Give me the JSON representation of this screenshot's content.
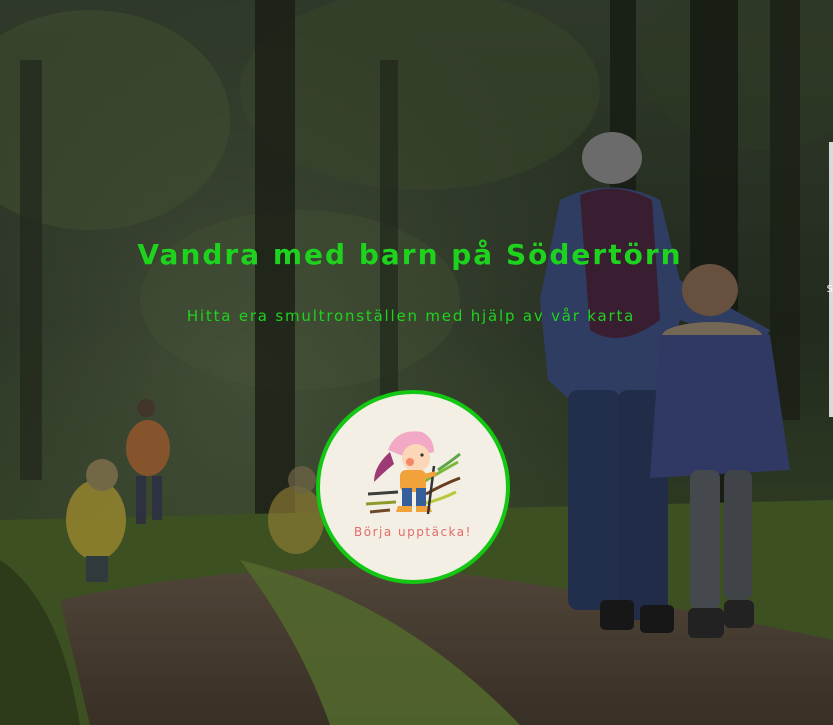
{
  "hero": {
    "title": "Vandra med barn på Södertörn",
    "subtitle": "Hitta era smultronställen med hjälp av vår karta",
    "cta_label": "Börja upptäcka!",
    "background_image": "forest-path-family-hiking-photo",
    "edge_text": "S"
  },
  "colors": {
    "title": "#1ed31e",
    "cta_border": "#13c713",
    "cta_background": "#f3efe4",
    "cta_text": "#e56b6b"
  }
}
